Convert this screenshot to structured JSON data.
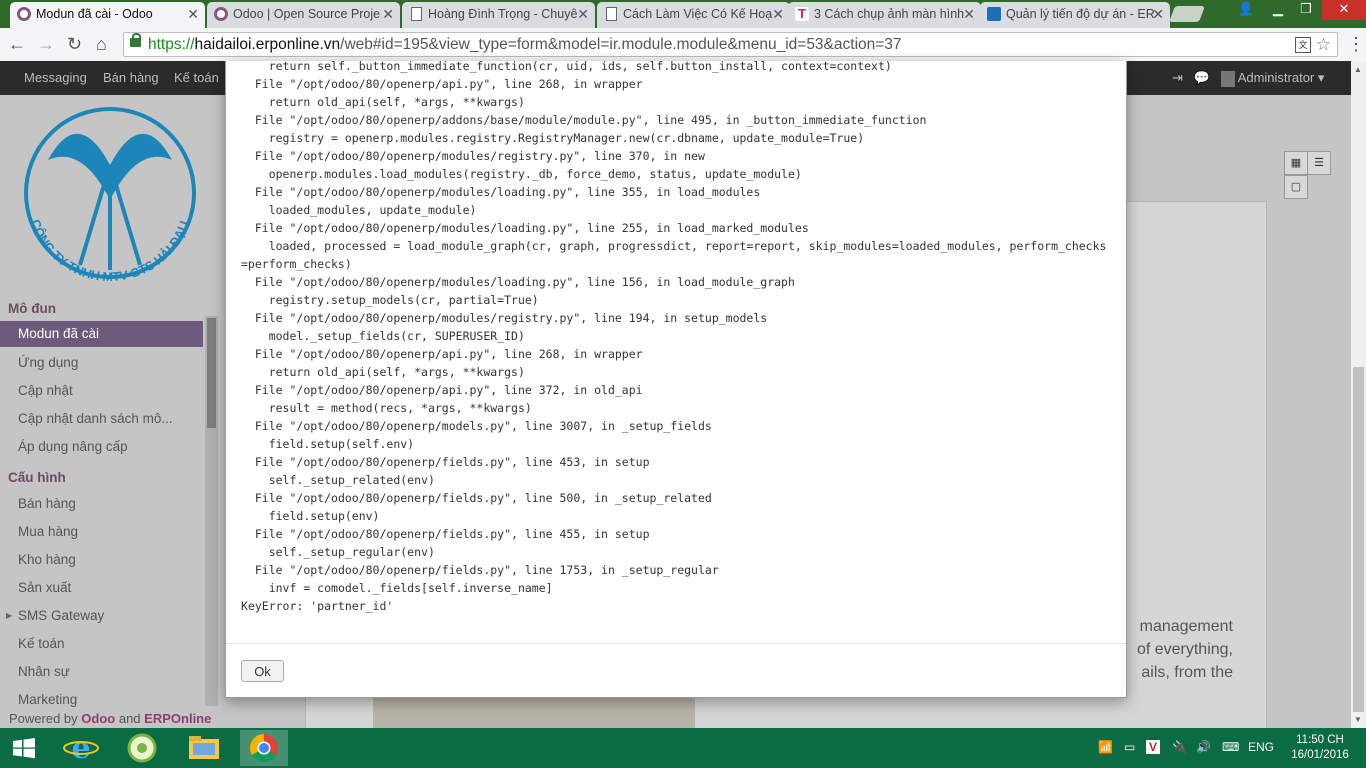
{
  "browser": {
    "tabs": [
      {
        "title": "Modun đã cài - Odoo",
        "icon": "odoo-icon",
        "active": true
      },
      {
        "title": "Odoo | Open Source Proje",
        "icon": "odoo-icon",
        "active": false
      },
      {
        "title": "Hoàng Đình Trọng - Chuyê",
        "icon": "document-icon",
        "active": false
      },
      {
        "title": "Cách Làm Việc Có Kế Hoạ",
        "icon": "document-icon",
        "active": false
      },
      {
        "title": "3 Cách chụp ảnh màn hình",
        "icon": "t-icon",
        "active": false
      },
      {
        "title": "Quản lý tiến độ dự án - ER",
        "icon": "grid-icon",
        "active": false
      }
    ],
    "url_scheme": "https://",
    "url_host": "haidailoi.erponline.vn",
    "url_rest": "/web#id=195&view_type=form&model=ir.module.module&menu_id=53&action=37"
  },
  "odoo": {
    "topmenu": [
      "Messaging",
      "Bán hàng",
      "Kế toán"
    ],
    "user": "Administrator",
    "logo_text": "CÔNG TY TNHH MTV GTS HẢI ĐẠI LỢI",
    "sidebar": {
      "section1": "Mô đun",
      "section1_items": [
        "Modun đã cài",
        "Ứng dụng",
        "Cập nhật",
        "Cập nhật danh sách mô...",
        "Áp dụng nâng cấp"
      ],
      "section2": "Cấu hình",
      "section2_items": [
        "Bán hàng",
        "Mua hàng",
        "Kho hàng",
        "Sản xuất",
        "SMS Gateway",
        "Kế toán",
        "Nhân sự",
        "Marketing"
      ]
    },
    "powered_prefix": "Powered by",
    "powered_odoo": "Odoo",
    "powered_and": "and",
    "powered_erp": "ERPOnline",
    "bg_text": [
      "management",
      "of everything,",
      "ails, from the"
    ]
  },
  "modal": {
    "traceback": "    return self._button_immediate_function(cr, uid, ids, self.button_install, context=context)\n  File \"/opt/odoo/80/openerp/api.py\", line 268, in wrapper\n    return old_api(self, *args, **kwargs)\n  File \"/opt/odoo/80/openerp/addons/base/module/module.py\", line 495, in _button_immediate_function\n    registry = openerp.modules.registry.RegistryManager.new(cr.dbname, update_module=True)\n  File \"/opt/odoo/80/openerp/modules/registry.py\", line 370, in new\n    openerp.modules.load_modules(registry._db, force_demo, status, update_module)\n  File \"/opt/odoo/80/openerp/modules/loading.py\", line 355, in load_modules\n    loaded_modules, update_module)\n  File \"/opt/odoo/80/openerp/modules/loading.py\", line 255, in load_marked_modules\n    loaded, processed = load_module_graph(cr, graph, progressdict, report=report, skip_modules=loaded_modules, perform_checks=perform_checks)\n  File \"/opt/odoo/80/openerp/modules/loading.py\", line 156, in load_module_graph\n    registry.setup_models(cr, partial=True)\n  File \"/opt/odoo/80/openerp/modules/registry.py\", line 194, in setup_models\n    model._setup_fields(cr, SUPERUSER_ID)\n  File \"/opt/odoo/80/openerp/api.py\", line 268, in wrapper\n    return old_api(self, *args, **kwargs)\n  File \"/opt/odoo/80/openerp/api.py\", line 372, in old_api\n    result = method(recs, *args, **kwargs)\n  File \"/opt/odoo/80/openerp/models.py\", line 3007, in _setup_fields\n    field.setup(self.env)\n  File \"/opt/odoo/80/openerp/fields.py\", line 453, in setup\n    self._setup_related(env)\n  File \"/opt/odoo/80/openerp/fields.py\", line 500, in _setup_related\n    field.setup(env)\n  File \"/opt/odoo/80/openerp/fields.py\", line 455, in setup\n    self._setup_regular(env)\n  File \"/opt/odoo/80/openerp/fields.py\", line 1753, in _setup_regular\n    invf = comodel._fields[self.inverse_name]\nKeyError: 'partner_id'",
    "ok_label": "Ok"
  },
  "taskbar": {
    "apps": [
      "start-button",
      "internet-explorer-icon",
      "coccoc-icon",
      "file-explorer-icon",
      "chrome-icon"
    ],
    "lang": "ENG",
    "time": "11:50 CH",
    "date": "16/01/2016"
  }
}
